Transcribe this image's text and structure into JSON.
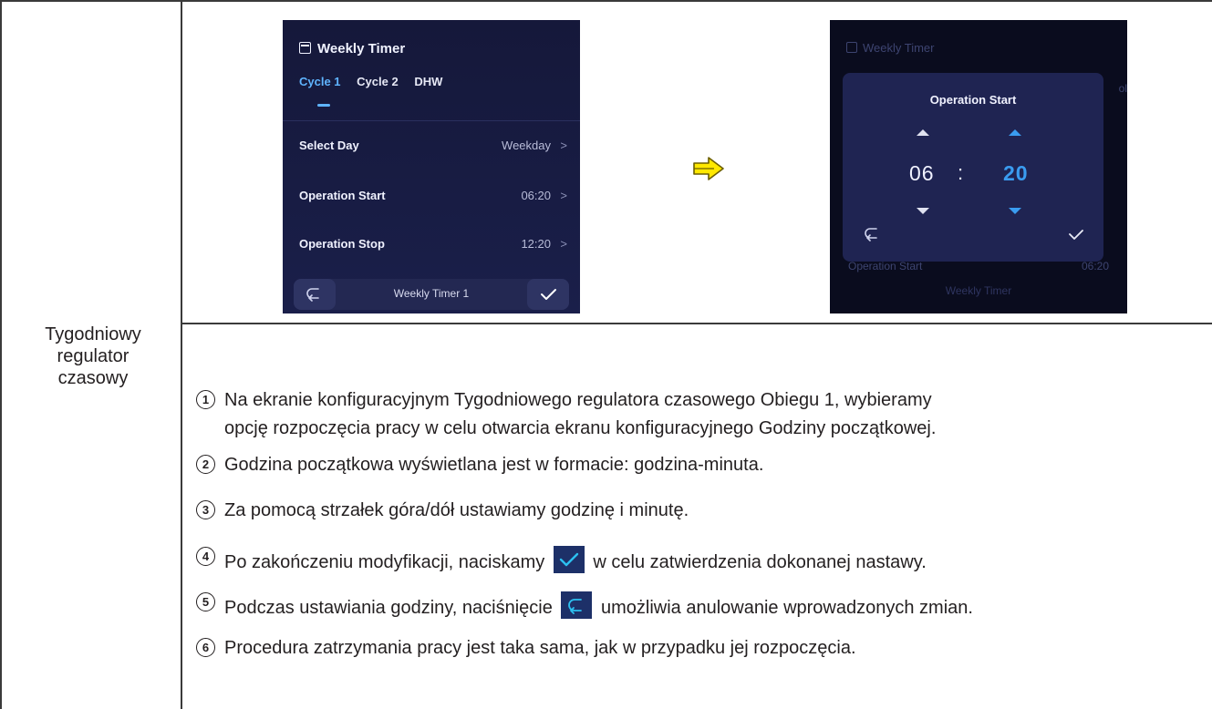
{
  "row_label": [
    "Tygodniowy",
    "regulator",
    "czasowy"
  ],
  "screen1": {
    "title": "Weekly Timer",
    "tabs": [
      "Cycle 1",
      "Cycle 2",
      "DHW"
    ],
    "rows": [
      {
        "label": "Select Day",
        "value": "Weekday"
      },
      {
        "label": "Operation Start",
        "value": "06:20"
      },
      {
        "label": "Operation Stop",
        "value": "12:20"
      }
    ],
    "bottom_label": "Weekly Timer 1"
  },
  "screen2": {
    "background_title": "Weekly Timer",
    "background_clipped": "ol",
    "background_row_label": "Operation Start",
    "background_row_value": "06:20",
    "background_bottom": "Weekly Timer",
    "popup_title": "Operation Start",
    "hour": "06",
    "separator": ":",
    "minute": "20"
  },
  "steps": [
    {
      "num": "1",
      "lines": [
        "Na ekranie konfiguracyjnym Tygodniowego regulatora czasowego Obiegu 1, wybieramy",
        "opcję rozpoczęcia pracy w celu otwarcia ekranu konfiguracyjnego Godziny początkowej."
      ]
    },
    {
      "num": "2",
      "text": "Godzina początkowa wyświetlana jest w formacie: godzina-minuta."
    },
    {
      "num": "3",
      "text": "Za pomocą strzałek góra/dół ustawiamy godzinę i minutę."
    },
    {
      "num": "4",
      "before": "Po zakończeniu modyfikacji, naciskamy",
      "after": "w celu zatwierdzenia dokonanej nastawy."
    },
    {
      "num": "5",
      "before": "Podczas ustawiania godziny, naciśnięcie",
      "after": "umożliwia anulowanie wprowadzonych zmian."
    },
    {
      "num": "6",
      "text": "Procedura zatrzymania pracy jest taka sama, jak w przypadku jej rozpoczęcia."
    }
  ],
  "colors": {
    "accent": "#3a9cf0",
    "tab_active": "#5fb4ff",
    "icon_box": "#1d3068",
    "arrow": "#ffe800"
  }
}
